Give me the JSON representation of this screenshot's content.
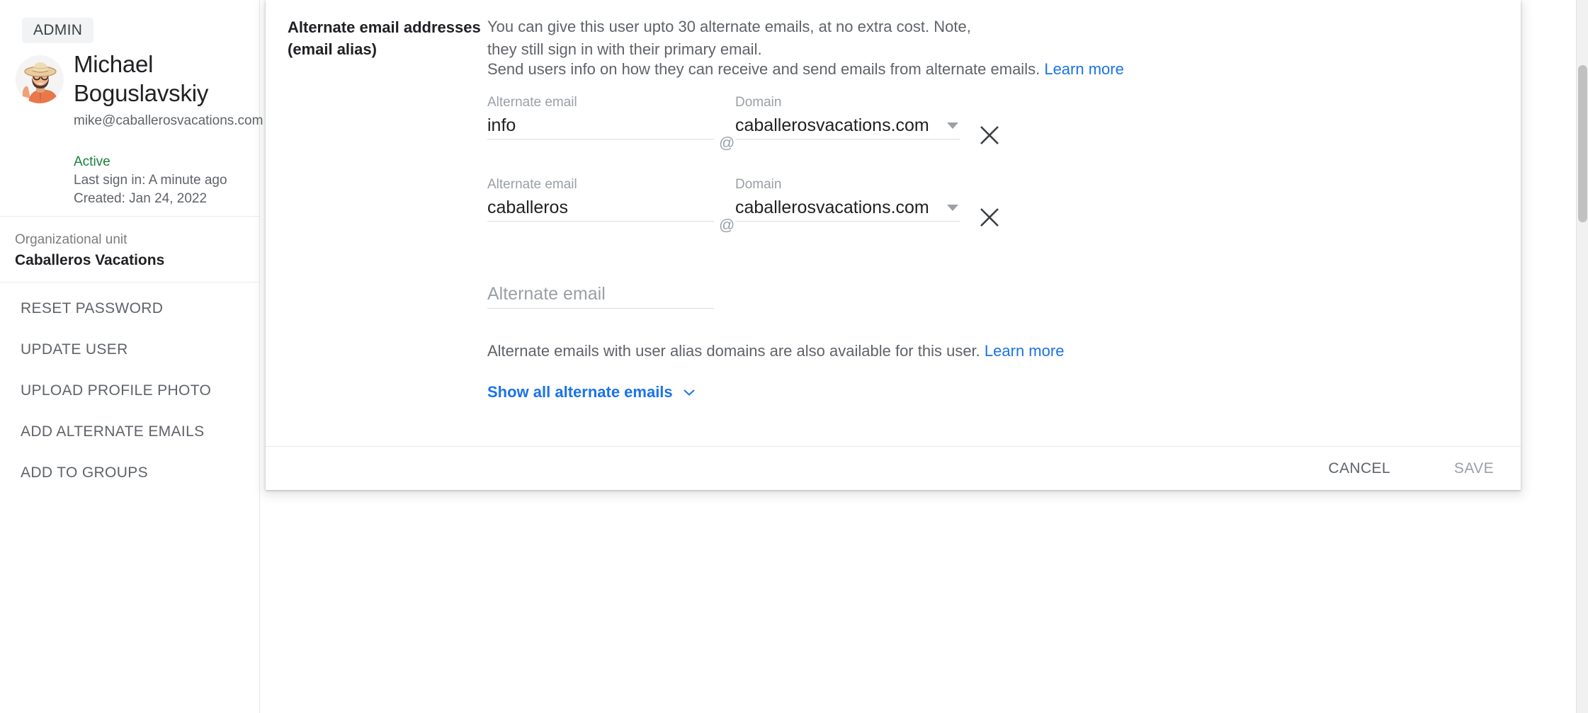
{
  "sidebar": {
    "admin_badge": "ADMIN",
    "avatar_icon": "user-avatar-sombrero",
    "user_name": "Michael Boguslavskiy",
    "user_email": "mike@caballerosvacations.com",
    "status": "Active",
    "last_sign_in": "Last sign in: A minute ago",
    "created": "Created: Jan 24, 2022",
    "org_unit_label": "Organizational unit",
    "org_unit_value": "Caballeros Vacations",
    "nav_items": [
      {
        "label": "RESET PASSWORD"
      },
      {
        "label": "UPDATE USER"
      },
      {
        "label": "UPLOAD PROFILE PHOTO"
      },
      {
        "label": "ADD ALTERNATE EMAILS"
      },
      {
        "label": "ADD TO GROUPS"
      }
    ]
  },
  "dialog": {
    "section_title": "Alternate email addresses (email alias)",
    "description_1": "You can give this user upto 30 alternate emails, at no extra cost. Note, they still sign in with their primary email.",
    "description_2_text": "Send users info on how they can receive and send emails from alternate emails.",
    "description_2_link": "Learn more",
    "field_labels": {
      "alternate_email": "Alternate email",
      "domain": "Domain"
    },
    "at_symbol": "@",
    "rows": [
      {
        "local": "info",
        "domain": "caballerosvacations.com",
        "remove_icon": "close-icon",
        "dropdown_icon": "chevron-down-icon"
      },
      {
        "local": "caballeros",
        "domain": "caballerosvacations.com",
        "remove_icon": "close-icon",
        "dropdown_icon": "chevron-down-icon"
      }
    ],
    "new_row": {
      "placeholder": "Alternate email"
    },
    "note_text": "Alternate emails with user alias domains are also available for this user.",
    "note_link": "Learn more",
    "show_all_label": "Show all alternate emails",
    "show_all_icon": "chevron-down-icon",
    "footer": {
      "cancel_label": "CANCEL",
      "save_label": "SAVE"
    }
  },
  "colors": {
    "link": "#1a73e8",
    "status_active": "#188038",
    "text_primary": "#202124",
    "text_secondary": "#5f6368",
    "text_muted": "#9aa0a6",
    "divider": "#e8eaed"
  }
}
